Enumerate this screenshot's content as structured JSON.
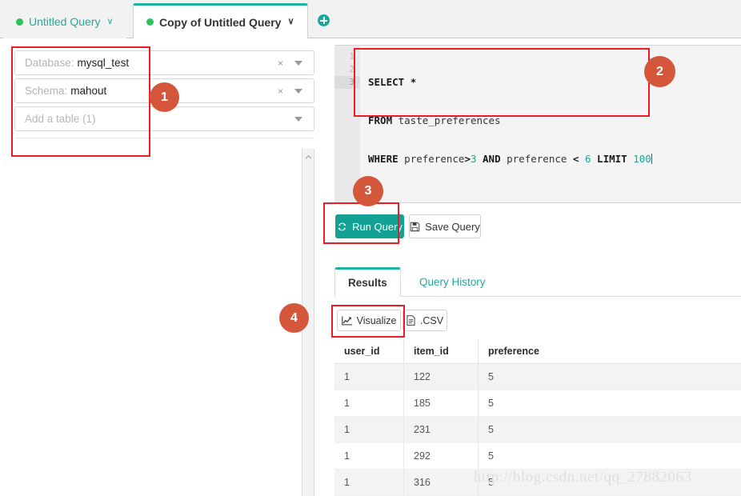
{
  "tabs": {
    "inactive_tab": {
      "label": "Untitled Query",
      "dot": "status-dot",
      "caret": "∨"
    },
    "active_tab": {
      "label": "Copy of Untitled Query",
      "dot": "status-dot",
      "caret": "∨"
    },
    "add_tab_icon": "plus-circle-icon"
  },
  "sidebar": {
    "database": {
      "label": "Database:",
      "value": "mysql_test",
      "clear": "×",
      "arrow": "chevron-down-icon"
    },
    "schema": {
      "label": "Schema:",
      "value": "mahout",
      "clear": "×",
      "arrow": "chevron-down-icon"
    },
    "table": {
      "placeholder": "Add a table (1)",
      "arrow": "chevron-down-icon"
    },
    "collapse_chevron": "⌃"
  },
  "editor": {
    "line_numbers": [
      "1",
      "2",
      "3"
    ],
    "lines": [
      {
        "tokens": [
          {
            "t": "SELECT",
            "c": "kw"
          },
          {
            "t": " ",
            "c": "idn"
          },
          {
            "t": "*",
            "c": "op"
          }
        ]
      },
      {
        "tokens": [
          {
            "t": "FROM",
            "c": "kw"
          },
          {
            "t": " taste_preferences",
            "c": "idn"
          }
        ]
      },
      {
        "tokens": [
          {
            "t": "WHERE",
            "c": "kw"
          },
          {
            "t": " preference",
            "c": "idn"
          },
          {
            "t": ">",
            "c": "op"
          },
          {
            "t": "3",
            "c": "num"
          },
          {
            "t": " ",
            "c": "idn"
          },
          {
            "t": "AND",
            "c": "kw"
          },
          {
            "t": " preference ",
            "c": "idn"
          },
          {
            "t": "<",
            "c": "op"
          },
          {
            "t": " ",
            "c": "idn"
          },
          {
            "t": "6",
            "c": "num"
          },
          {
            "t": " ",
            "c": "idn"
          },
          {
            "t": "LIMIT",
            "c": "kw"
          },
          {
            "t": " ",
            "c": "idn"
          },
          {
            "t": "100",
            "c": "num"
          }
        ]
      }
    ],
    "full_sql": "SELECT *\nFROM taste_preferences\nWHERE preference>3 AND preference < 6 LIMIT 100"
  },
  "actions": {
    "run_query": {
      "label": "Run Query",
      "icon": "refresh-icon",
      "color": "#12a193"
    },
    "save_query": {
      "label": "Save Query",
      "icon": "floppy-disk-icon"
    }
  },
  "result_tabs": {
    "results": "Results",
    "query_history": "Query History"
  },
  "export": {
    "visualize": {
      "label": "Visualize",
      "icon": "line-chart-icon"
    },
    "csv": {
      "label": ".CSV",
      "icon": "file-icon"
    }
  },
  "table": {
    "columns": [
      "user_id",
      "item_id",
      "preference"
    ],
    "rows": [
      [
        "1",
        "122",
        "5"
      ],
      [
        "1",
        "185",
        "5"
      ],
      [
        "1",
        "231",
        "5"
      ],
      [
        "1",
        "292",
        "5"
      ],
      [
        "1",
        "316",
        "5"
      ]
    ]
  },
  "annotations": {
    "badges": [
      {
        "n": "1"
      },
      {
        "n": "2"
      },
      {
        "n": "3"
      },
      {
        "n": "4"
      }
    ],
    "badge_color": "#d4573c",
    "box_color": "#ec1c24"
  },
  "watermark": "http://blog.csdn.net/qq_27882063"
}
